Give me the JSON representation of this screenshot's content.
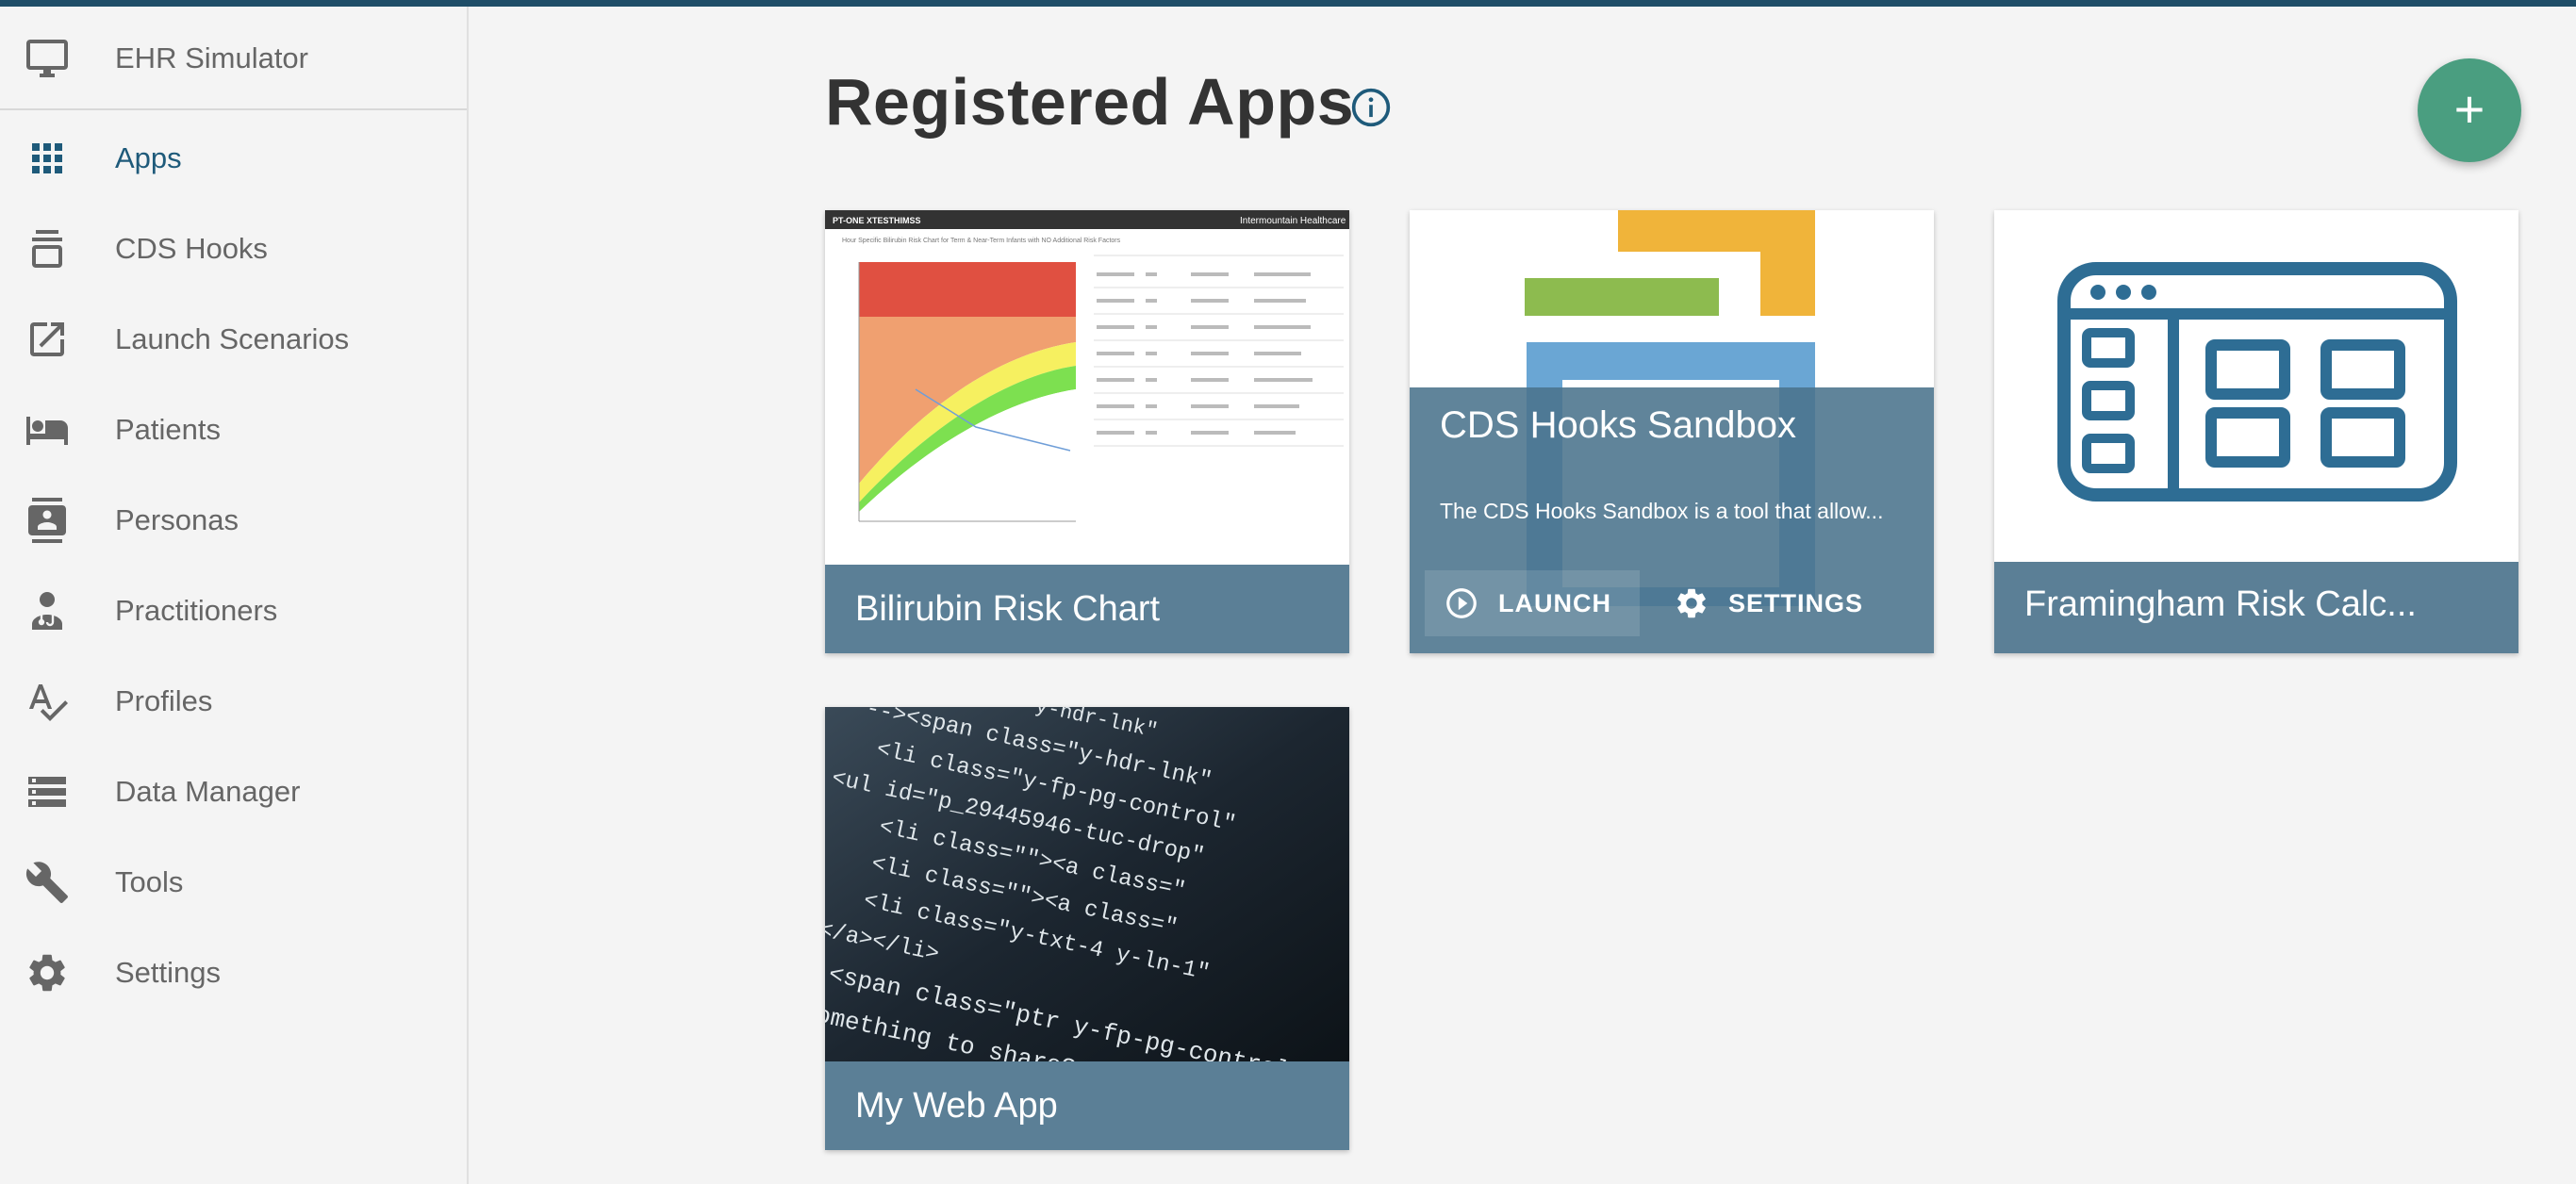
{
  "sidebar": {
    "header": {
      "label": "EHR Simulator",
      "icon": "monitor-icon"
    },
    "items": [
      {
        "label": "Apps",
        "icon": "apps-grid-icon",
        "active": true
      },
      {
        "label": "CDS Hooks",
        "icon": "cds-hooks-icon"
      },
      {
        "label": "Launch Scenarios",
        "icon": "open-in-new-icon"
      },
      {
        "label": "Patients",
        "icon": "hotel-bed-icon"
      },
      {
        "label": "Personas",
        "icon": "contact-card-icon"
      },
      {
        "label": "Practitioners",
        "icon": "doctor-icon"
      },
      {
        "label": "Profiles",
        "icon": "spellcheck-icon"
      },
      {
        "label": "Data Manager",
        "icon": "storage-icon"
      },
      {
        "label": "Tools",
        "icon": "wrench-icon"
      },
      {
        "label": "Settings",
        "icon": "gear-icon"
      }
    ]
  },
  "main": {
    "title": "Registered Apps",
    "info_icon": "info-icon",
    "add_button_icon": "plus-icon",
    "add_button_label": "+"
  },
  "apps": [
    {
      "name": "Bilirubin Risk Chart"
    },
    {
      "name": "CDS Hooks Sandbox",
      "description": "The CDS Hooks Sandbox is a tool that allow...",
      "launch_label": "LAUNCH",
      "settings_label": "SETTINGS"
    },
    {
      "name": "Framingham Risk Calc..."
    },
    {
      "name": "My Web App"
    }
  ],
  "thumb_text": {
    "bilirubin_header": "PT-ONE XTESTHIMSS",
    "bilirubin_brand": "Intermountain Healthcare",
    "bilirubin_chart_title": "Hour Specific Bilirubin Risk Chart for Term & Near-Term Infants with NO Additional Risk Factors",
    "code_lines": [
      "<li class=\"y-hdr-lnk\"",
      "--><span class=\"y-hdr-lnk\"",
      "<li class=\"y-fp-pg-control\"",
      "<ul id=\"p_29445946-tuc-drop\"",
      "<li class=\"\"><a class=\"",
      "<li class=\"\"><a class=\"",
      "<li class=\"y-txt-4 y-ln-1\"",
      "</a></li>",
      "<span class=\"ptr y-fp-pg-controls\"",
      "something to share?</a>"
    ]
  },
  "colors": {
    "accent": "#1e5a7a",
    "fab": "#4a9e80",
    "card_bar": "#5b7f96",
    "topbar": "#1f4e68"
  }
}
